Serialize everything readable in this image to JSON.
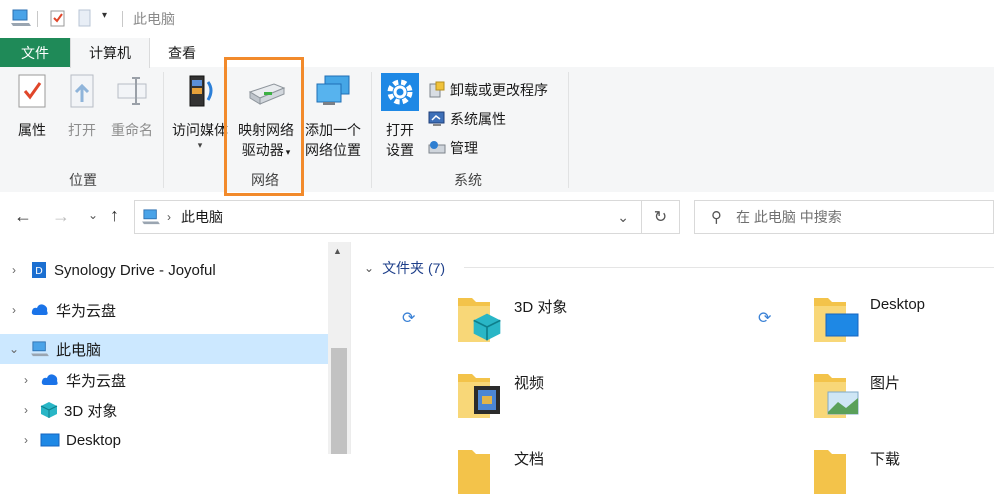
{
  "window": {
    "title": "此电脑"
  },
  "tabs": {
    "file": "文件",
    "computer": "计算机",
    "view": "查看"
  },
  "ribbon": {
    "location_group": {
      "label": "位置",
      "properties": "属性",
      "open": "打开",
      "rename": "重命名"
    },
    "network_group": {
      "label": "网络",
      "access_media": "访问媒体",
      "map_drive_line1": "映射网络",
      "map_drive_line2": "驱动器",
      "add_location_line1": "添加一个",
      "add_location_line2": "网络位置"
    },
    "system_group": {
      "label": "系统",
      "open_settings_line1": "打开",
      "open_settings_line2": "设置",
      "uninstall": "卸载或更改程序",
      "system_properties": "系统属性",
      "manage": "管理"
    }
  },
  "address": {
    "path": "此电脑",
    "search_placeholder": "在 此电脑 中搜索"
  },
  "nav_tree": [
    {
      "label": "Synology Drive - Joyoful",
      "indent": 0
    },
    {
      "label": "华为云盘",
      "indent": 0
    },
    {
      "label": "此电脑",
      "indent": 0,
      "selected": true,
      "expanded": true
    },
    {
      "label": "华为云盘",
      "indent": 1
    },
    {
      "label": "3D 对象",
      "indent": 1
    },
    {
      "label": "Desktop",
      "indent": 1
    }
  ],
  "content": {
    "section_title": "文件夹 (7)",
    "folders": [
      {
        "name": "3D 对象"
      },
      {
        "name": "Desktop"
      },
      {
        "name": "视频"
      },
      {
        "name": "图片"
      },
      {
        "name": "文档"
      },
      {
        "name": "下载"
      }
    ]
  },
  "colors": {
    "file_tab": "#1f8a58",
    "highlight": "#f28a2b",
    "selected_row": "#cce8ff"
  }
}
